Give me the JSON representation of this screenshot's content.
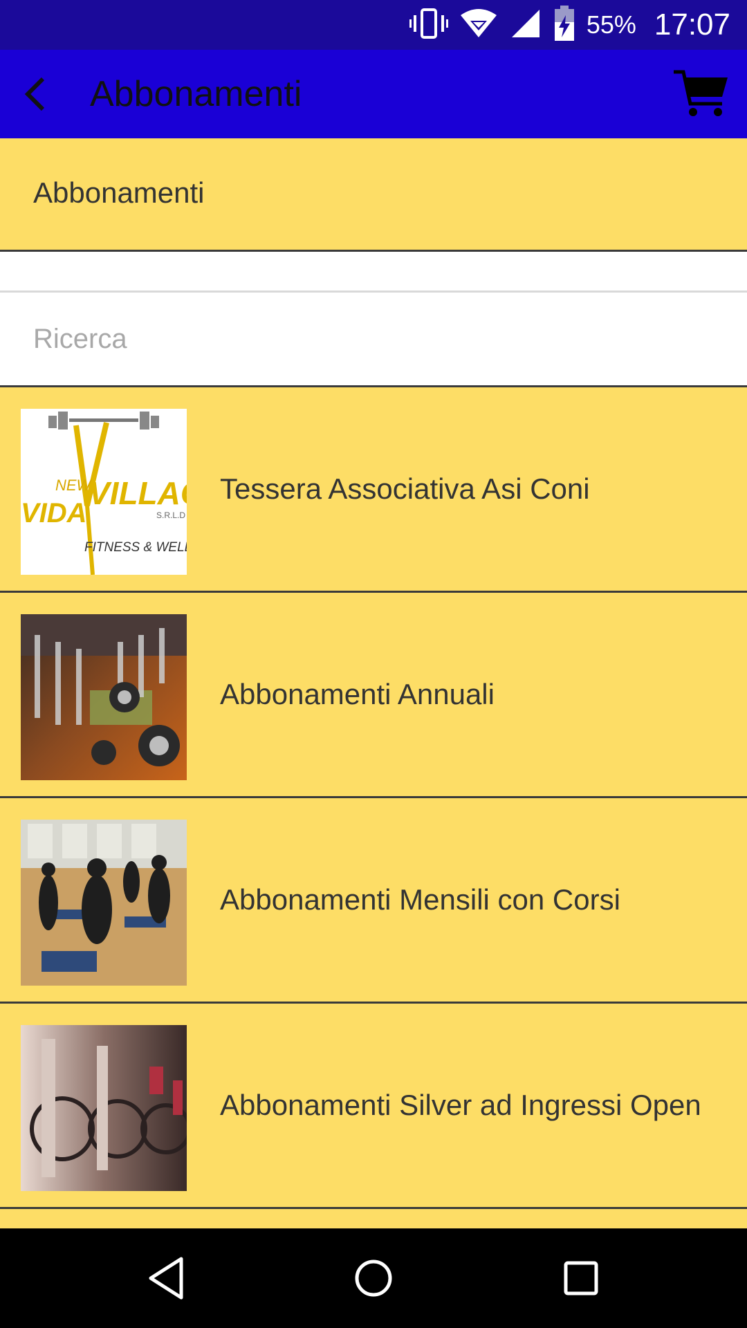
{
  "status_bar": {
    "battery_percent": "55%",
    "time": "17:07",
    "icons": [
      "vibrate-icon",
      "wifi-icon",
      "signal-icon",
      "battery-charging-icon"
    ]
  },
  "app_bar": {
    "title": "Abbonamenti",
    "back_icon": "back-arrow-icon",
    "cart_icon": "cart-icon"
  },
  "section": {
    "title": "Abbonamenti"
  },
  "search": {
    "placeholder": "Ricerca",
    "value": ""
  },
  "items": [
    {
      "name": "Tessera Associativa Asi Coni",
      "image": "logo-new-village"
    },
    {
      "name": "Abbonamenti Annuali",
      "image": "photo-gym-machines"
    },
    {
      "name": "Abbonamenti Mensili con Corsi",
      "image": "photo-group-class"
    },
    {
      "name": "Abbonamenti Silver ad Ingressi Open",
      "image": "photo-spin-bikes"
    }
  ],
  "logo": {
    "line1": "NEW",
    "line2": "VILLAGE",
    "line3": "S.R.L.D",
    "line4": "FITNESS & WELLNESS"
  },
  "nav_bar": {
    "buttons": [
      "back-icon",
      "home-icon",
      "recents-icon"
    ]
  },
  "colors": {
    "status_bar": "#1b0a9a",
    "app_bar": "#1a00d6",
    "background": "#fddd66",
    "divider": "#3a3a3a"
  }
}
